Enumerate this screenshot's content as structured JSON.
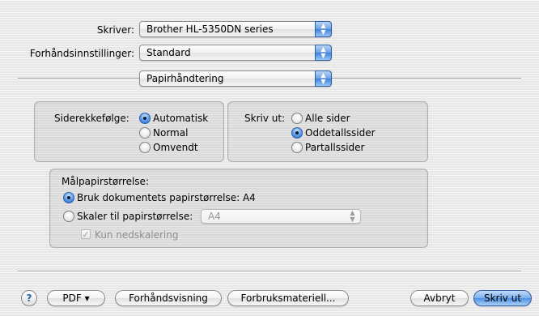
{
  "printer": {
    "label": "Skriver:",
    "value": "Brother HL-5350DN series"
  },
  "presets": {
    "label": "Forhåndsinnstillinger:",
    "value": "Standard"
  },
  "panel": {
    "value": "Papirhåndtering"
  },
  "page_order": {
    "label": "Siderekkefølge:",
    "options": [
      "Automatisk",
      "Normal",
      "Omvendt"
    ],
    "selected": "Automatisk"
  },
  "print": {
    "label": "Skriv ut:",
    "options": [
      "Alle sider",
      "Oddetallssider",
      "Partallssider"
    ],
    "selected": "Oddetallssider"
  },
  "paper": {
    "title": "Målpapirstørrelse:",
    "use_doc_label": "Bruk dokumentets papirstørrelse: A4",
    "scale_label": "Skaler til papirstørrelse:",
    "scale_value": "A4",
    "scale_down_label": "Kun nedskalering",
    "selected": "use_doc"
  },
  "bottom": {
    "help_label": "?",
    "pdf_label": "PDF ▾",
    "preview_label": "Forhåndsvisning",
    "supplies_label": "Forbruksmateriell...",
    "cancel_label": "Avbryt",
    "print_label": "Skriv ut"
  },
  "icons": {
    "popup_arrows": "up-down-arrows-icon",
    "check": "checkmark-icon"
  },
  "colors": {
    "accent": "#4d8fe2",
    "window_bg": "#e7e7e7"
  }
}
